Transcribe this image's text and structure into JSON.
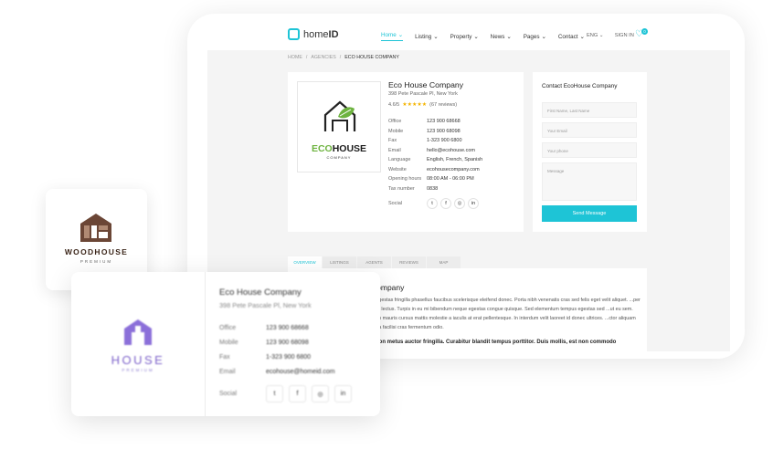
{
  "header": {
    "logo_text_a": "home",
    "logo_text_b": "ID",
    "nav": [
      "Home",
      "Listing",
      "Property",
      "News",
      "Pages",
      "Contact"
    ],
    "lang": "ENG",
    "signin": "SIGN IN",
    "wishlist_count": "0"
  },
  "breadcrumb": {
    "home": "HOME",
    "sep": "/",
    "agencies": "AGENCIES",
    "current": "ECO HOUSE COMPANY"
  },
  "company": {
    "name": "Eco House Company",
    "address": "398 Pete Pascale Pl, New York",
    "rating": "4.6/5",
    "reviews": "(67 reviews)",
    "logo_main_a": "ECO",
    "logo_main_b": "HOUSE",
    "logo_sub": "COMPANY",
    "details": [
      {
        "label": "Office",
        "value": "123 900 68668"
      },
      {
        "label": "Mobile",
        "value": "123 900 68098"
      },
      {
        "label": "Fax",
        "value": "1-323 900 6800"
      },
      {
        "label": "Email",
        "value": "hello@ecohouse.com"
      },
      {
        "label": "Language",
        "value": "English, French, Spanish"
      },
      {
        "label": "Website",
        "value": "ecohousecompany.com"
      },
      {
        "label": "Opening hours",
        "value": "08:00 AM - 06:00 PM"
      },
      {
        "label": "Tax number",
        "value": "0838"
      }
    ],
    "social_label": "Social",
    "social_icons": [
      "t",
      "f",
      "◎",
      "in"
    ]
  },
  "contact": {
    "title": "Contact EcoHouse Company",
    "name_ph": "First Name, Last Name",
    "email_ph": "Your Email",
    "phone_ph": "Your phone",
    "message_ph": "Message",
    "send": "Send Message"
  },
  "tabs": [
    "OVERVIEW",
    "LISTINGS",
    "AGENTS",
    "REVIEWS",
    "MAP"
  ],
  "overview": {
    "title": "Company",
    "text": "... ligestas fringilla phasellus faucibus scelerisque eleifend donec. Porta nibh venenatis cras sed felis eget velit aliquet. ...per quis lectus. Turpis in eu mi bibendum neque egestas congue quisque. Sed elementum tempus egestas sed ...ut eu sem. Nibh mauris cursus mattis molestie a iaculis at erat pellentesque. In interdum velit laoreet id donec ultrices. ...ctor aliquam nulla facilisi cras fermentum odio.",
    "bold": "...non metus auctor fringilla. Curabitur blandit tempus porttitor. Duis mollis, est non commodo"
  },
  "woodhouse": {
    "name": "WOODHOUSE",
    "sub": "PREMIUM"
  },
  "house_card": {
    "logo_name": "HOUSE",
    "logo_sub": "PREMIUM",
    "name": "Eco House Company",
    "address": "398 Pete Pascale Pl, New York",
    "details": [
      {
        "label": "Office",
        "value": "123 900 68668"
      },
      {
        "label": "Mobile",
        "value": "123 900 68098"
      },
      {
        "label": "Fax",
        "value": "1-323 900 6800"
      },
      {
        "label": "Email",
        "value": "ecohouse@homeid.com"
      }
    ],
    "social_label": "Social"
  },
  "colors": {
    "accent": "#1ec4d6",
    "eco_green": "#6db33f",
    "wood": "#6b4636",
    "house_purple": "#7a5fc9"
  }
}
